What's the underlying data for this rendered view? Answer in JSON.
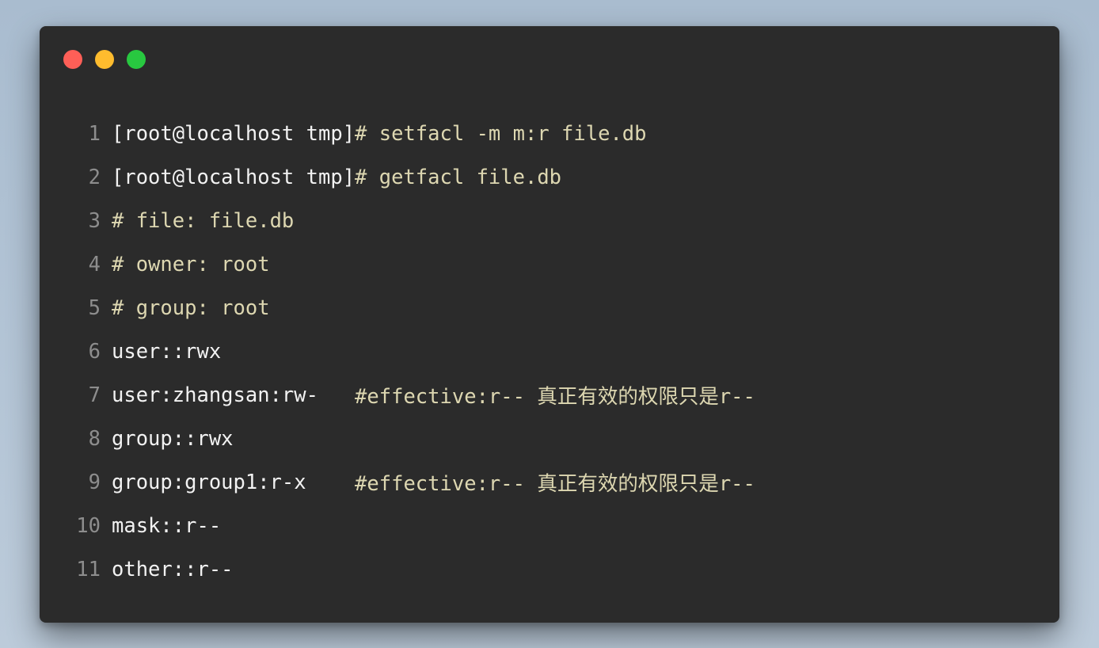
{
  "window": {
    "buttons": [
      {
        "name": "close",
        "color": "#fe5f57"
      },
      {
        "name": "minimize",
        "color": "#febc2e"
      },
      {
        "name": "zoom",
        "color": "#28c840"
      }
    ]
  },
  "code": {
    "colors": {
      "plain": "#f2f2f2",
      "accent": "#ddd7b1",
      "line_number": "#8d8d8d",
      "background": "#2b2b2b"
    },
    "lines": [
      {
        "n": "1",
        "segments": [
          {
            "text": "[root@localhost tmp]",
            "style": "white"
          },
          {
            "text": "# setfacl -m m:r file.db",
            "style": "yellowish"
          }
        ]
      },
      {
        "n": "2",
        "segments": [
          {
            "text": "[root@localhost tmp]",
            "style": "white"
          },
          {
            "text": "# getfacl file.db",
            "style": "yellowish"
          }
        ]
      },
      {
        "n": "3",
        "segments": [
          {
            "text": "# file: file.db",
            "style": "yellowish"
          }
        ]
      },
      {
        "n": "4",
        "segments": [
          {
            "text": "# owner: root",
            "style": "yellowish"
          }
        ]
      },
      {
        "n": "5",
        "segments": [
          {
            "text": "# group: root",
            "style": "yellowish"
          }
        ]
      },
      {
        "n": "6",
        "segments": [
          {
            "text": "user::rwx",
            "style": "white"
          }
        ]
      },
      {
        "n": "7",
        "segments": [
          {
            "text": "user:zhangsan:rw-   ",
            "style": "white"
          },
          {
            "text": "#effective:r-- 真正有效的权限只是r--",
            "style": "yellowish"
          }
        ]
      },
      {
        "n": "8",
        "segments": [
          {
            "text": "group::rwx",
            "style": "white"
          }
        ]
      },
      {
        "n": "9",
        "segments": [
          {
            "text": "group:group1:r-x    ",
            "style": "white"
          },
          {
            "text": "#effective:r-- 真正有效的权限只是r--",
            "style": "yellowish"
          }
        ]
      },
      {
        "n": "10",
        "segments": [
          {
            "text": "mask::r--",
            "style": "white"
          }
        ]
      },
      {
        "n": "11",
        "segments": [
          {
            "text": "other::r--",
            "style": "white"
          }
        ]
      }
    ]
  }
}
